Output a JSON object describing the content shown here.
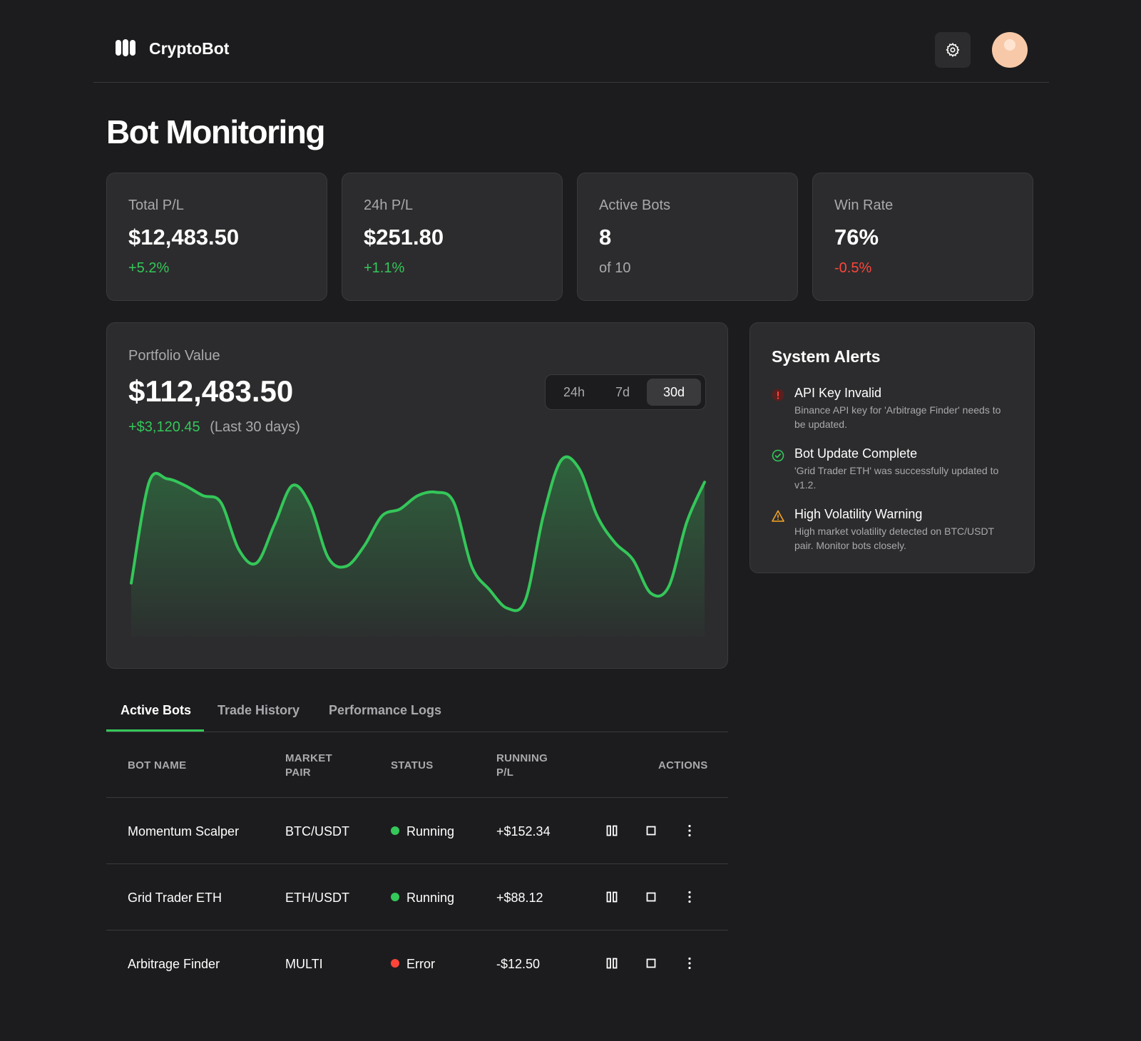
{
  "app": {
    "name": "CryptoBot"
  },
  "page": {
    "title": "Bot Monitoring"
  },
  "stats": [
    {
      "label": "Total P/L",
      "value": "$12,483.50",
      "change": "+5.2%",
      "tone": "positive"
    },
    {
      "label": "24h P/L",
      "value": "$251.80",
      "change": "+1.1%",
      "tone": "positive"
    },
    {
      "label": "Active Bots",
      "value": "8",
      "change": "of 10",
      "tone": "neutral"
    },
    {
      "label": "Win Rate",
      "value": "76%",
      "change": "-0.5%",
      "tone": "negative"
    }
  ],
  "portfolio": {
    "label": "Portfolio Value",
    "value": "$112,483.50",
    "change": "+$3,120.45",
    "period": "(Last 30 days)",
    "ranges": [
      "24h",
      "7d",
      "30d"
    ],
    "selected_range": "30d"
  },
  "chart_data": {
    "type": "area",
    "title": "",
    "xlabel": "",
    "ylabel": "",
    "values": [
      20,
      80,
      82,
      78,
      72,
      68,
      40,
      32,
      55,
      78,
      66,
      35,
      30,
      42,
      60,
      64,
      72,
      74,
      68,
      30,
      16,
      5,
      10,
      60,
      93,
      88,
      60,
      44,
      34,
      14,
      18,
      56,
      80
    ],
    "ylim": [
      0,
      100
    ],
    "color": "#34c759",
    "grid": false
  },
  "alerts": {
    "title": "System Alerts",
    "items": [
      {
        "type": "error",
        "title": "API Key Invalid",
        "description": "Binance API key for 'Arbitrage Finder' needs to be updated."
      },
      {
        "type": "success",
        "title": "Bot Update Complete",
        "description": "'Grid Trader ETH' was successfully updated to v1.2."
      },
      {
        "type": "warning",
        "title": "High Volatility Warning",
        "description": "High market volatility detected on BTC/USDT pair. Monitor bots closely."
      }
    ]
  },
  "tabs": [
    {
      "label": "Active Bots",
      "active": true
    },
    {
      "label": "Trade History",
      "active": false
    },
    {
      "label": "Performance Logs",
      "active": false
    }
  ],
  "table": {
    "headers": {
      "bot_name": "BOT NAME",
      "market_pair_1": "MARKET",
      "market_pair_2": "PAIR",
      "status": "STATUS",
      "running_pl_1": "RUNNING",
      "running_pl_2": "P/L",
      "actions": "ACTIONS"
    },
    "rows": [
      {
        "name": "Momentum Scalper",
        "pair": "BTC/USDT",
        "status": "Running",
        "status_color": "#34c759",
        "pl": "+$152.34",
        "pl_tone": "positive"
      },
      {
        "name": "Grid Trader ETH",
        "pair": "ETH/USDT",
        "status": "Running",
        "status_color": "#34c759",
        "pl": "+$88.12",
        "pl_tone": "positive"
      },
      {
        "name": "Arbitrage Finder",
        "pair": "MULTI",
        "status": "Error",
        "status_color": "#ff453a",
        "pl": "-$12.50",
        "pl_tone": "negative"
      }
    ]
  },
  "colors": {
    "background": "#1c1c1e",
    "card": "#2c2c2e",
    "accent_green": "#34c759",
    "accent_red": "#ff453a",
    "warning": "#f5a524"
  },
  "icons": {
    "logo": "bot-logo-icon",
    "settings": "gear-icon",
    "pause": "pause-icon",
    "stop": "stop-icon",
    "more": "more-vertical-icon"
  }
}
